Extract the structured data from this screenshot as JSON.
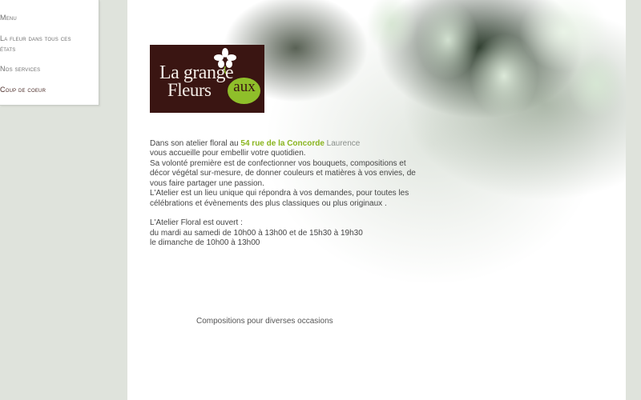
{
  "nav": {
    "items": [
      {
        "label": "Menu"
      },
      {
        "label": "La fleur dans tous ces"
      },
      {
        "label": "états"
      },
      {
        "label": "Nos services"
      },
      {
        "label": "Coup de coeur"
      }
    ]
  },
  "logo": {
    "line1": "La grange",
    "line2": "Fleurs",
    "badge": "aux"
  },
  "content": {
    "intro_prefix": " Dans son atelier floral au ",
    "intro_address": "54 rue de la Concorde",
    "intro_suffix_faint": " Laurence",
    "lines": [
      "vous accueille pour embellir votre quotidien.",
      "Sa volonté première est de confectionner vos bouquets, compositions et",
      "décor végétal sur-mesure, de donner couleurs et matières à vos envies, de",
      "vous faire partager une passion.",
      "L'Atelier est un lieu unique qui répondra à vos demandes, pour toutes les",
      "célébrations et évènements des plus classiques ou plus originaux ."
    ],
    "hours_title": " L'Atelier Floral est ouvert :",
    "hours_weekdays": "du mardi au samedi de 10h00 à 13h00 et de 15h30 à 19h30",
    "hours_sunday": "le dimanche de 10h00 à 13h00",
    "caption": "Compositions pour diverses occasions"
  },
  "colors": {
    "accent_green": "#8ab51e",
    "logo_background": "#3a1512",
    "page_background": "#dfe3dc"
  }
}
